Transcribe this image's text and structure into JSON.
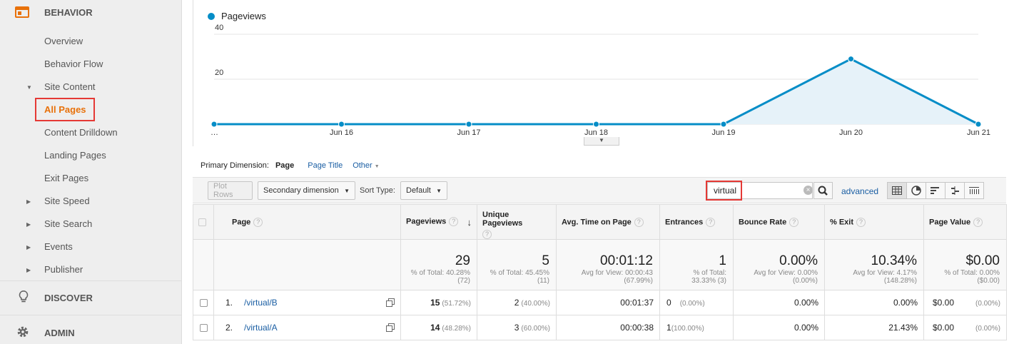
{
  "sidebar": {
    "behavior_label": "BEHAVIOR",
    "discover_label": "DISCOVER",
    "admin_label": "ADMIN",
    "items": {
      "overview": "Overview",
      "behavior_flow": "Behavior Flow",
      "site_content": "Site Content",
      "all_pages": "All Pages",
      "content_drilldown": "Content Drilldown",
      "landing_pages": "Landing Pages",
      "exit_pages": "Exit Pages",
      "site_speed": "Site Speed",
      "site_search": "Site Search",
      "events": "Events",
      "publisher": "Publisher"
    },
    "accent_color": "#e8710a"
  },
  "chart_data": {
    "type": "area",
    "series": [
      {
        "name": "Pageviews",
        "values": [
          0,
          0,
          0,
          0,
          0,
          29,
          0
        ],
        "color": "#058dc7"
      }
    ],
    "x": [
      "…",
      "Jun 16",
      "Jun 17",
      "Jun 18",
      "Jun 19",
      "Jun 20",
      "Jun 21"
    ],
    "y_ticks": [
      "40",
      "20"
    ],
    "ylim": [
      0,
      40
    ],
    "legend": "top-left",
    "grid": true
  },
  "primary_dimension": {
    "label": "Primary Dimension:",
    "selected": "Page",
    "option_page_title": "Page Title",
    "option_other": "Other"
  },
  "toolbar": {
    "plot_rows": "Plot Rows",
    "secondary_dimension": "Secondary dimension",
    "sort_type_label": "Sort Type:",
    "sort_type_value": "Default",
    "search_value": "virtual",
    "advanced": "advanced"
  },
  "table": {
    "headers": {
      "page": "Page",
      "pageviews": "Pageviews",
      "unique_pageviews": "Unique Pageviews",
      "avg_time": "Avg. Time on Page",
      "entrances": "Entrances",
      "bounce_rate": "Bounce Rate",
      "exit": "% Exit",
      "page_value": "Page Value"
    },
    "totals": {
      "pageviews": {
        "value": "29",
        "sub1": "% of Total: 40.28%",
        "sub2": "(72)"
      },
      "unique_pageviews": {
        "value": "5",
        "sub1": "% of Total: 45.45%",
        "sub2": "(11)"
      },
      "avg_time": {
        "value": "00:01:12",
        "sub1": "Avg for View: 00:00:43",
        "sub2": "(67.99%)"
      },
      "entrances": {
        "value": "1",
        "sub1": "% of Total:",
        "sub2": "33.33% (3)"
      },
      "bounce_rate": {
        "value": "0.00%",
        "sub1": "Avg for View: 0.00%",
        "sub2": "(0.00%)"
      },
      "exit": {
        "value": "10.34%",
        "sub1": "Avg for View: 4.17%",
        "sub2": "(148.28%)"
      },
      "page_value": {
        "value": "$0.00",
        "sub1": "% of Total: 0.00%",
        "sub2": "($0.00)"
      }
    },
    "rows": [
      {
        "index": "1.",
        "page": "/virtual/B",
        "pageviews": "15",
        "pageviews_pct": "(51.72%)",
        "unique": "2",
        "unique_pct": "(40.00%)",
        "avg_time": "00:01:37",
        "entrances": "0",
        "entrances_pct": "(0.00%)",
        "bounce": "0.00%",
        "exit": "0.00%",
        "value": "$0.00",
        "value_pct": "(0.00%)"
      },
      {
        "index": "2.",
        "page": "/virtual/A",
        "pageviews": "14",
        "pageviews_pct": "(48.28%)",
        "unique": "3",
        "unique_pct": "(60.00%)",
        "avg_time": "00:00:38",
        "entrances": "1",
        "entrances_pct": "(100.00%)",
        "bounce": "0.00%",
        "exit": "21.43%",
        "value": "$0.00",
        "value_pct": "(0.00%)"
      }
    ]
  }
}
